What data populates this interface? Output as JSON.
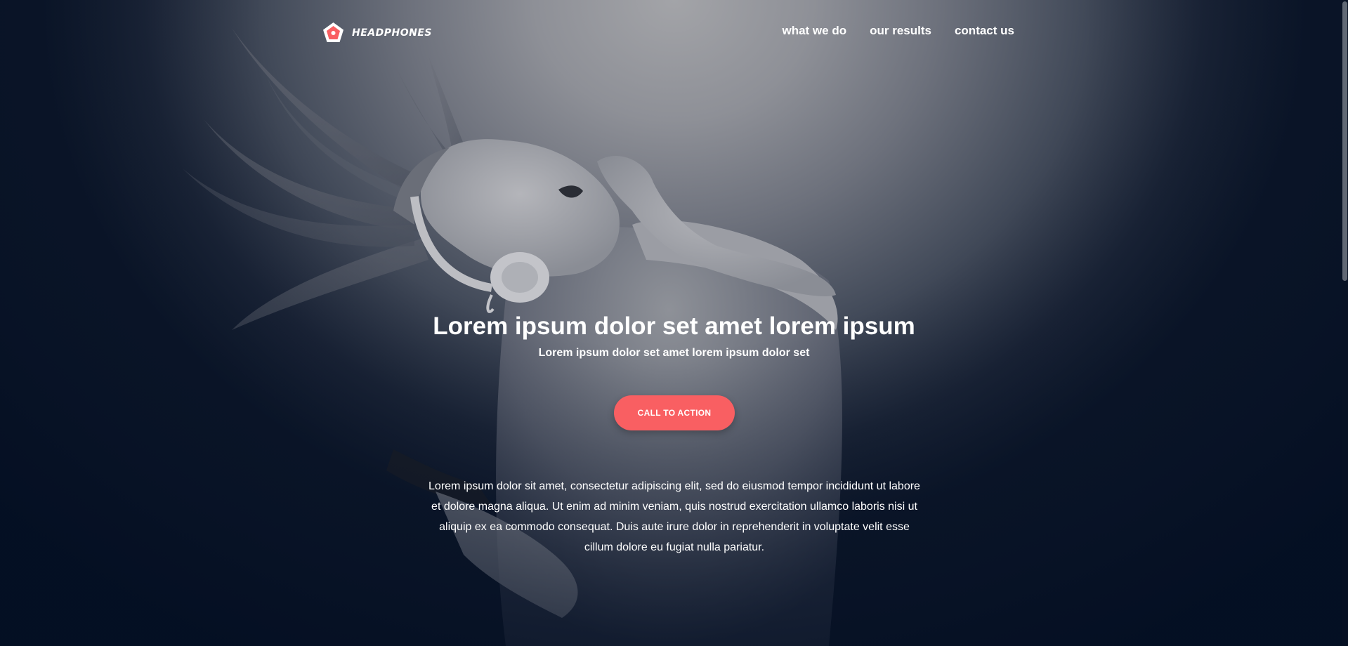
{
  "brand": {
    "logo_text": "HEADPHONES",
    "accent_color": "#f95f62"
  },
  "nav": {
    "items": [
      {
        "label": "what we do"
      },
      {
        "label": "our results"
      },
      {
        "label": "contact us"
      }
    ]
  },
  "hero": {
    "headline": "Lorem ipsum dolor set amet lorem ipsum",
    "subheadline": "Lorem ipsum dolor set amet lorem ipsum dolor set",
    "cta_label": "CALL TO ACTION",
    "body": "Lorem ipsum dolor sit amet, consectetur adipiscing elit, sed do eiusmod tempor incididunt ut labore et dolore magna aliqua. Ut enim ad minim veniam, quis nostrud exercitation ullamco laboris nisi ut aliquip ex ea commodo consequat. Duis aute irure dolor in reprehenderit in voluptate velit esse cillum dolore eu fugiat nulla pariatur."
  }
}
